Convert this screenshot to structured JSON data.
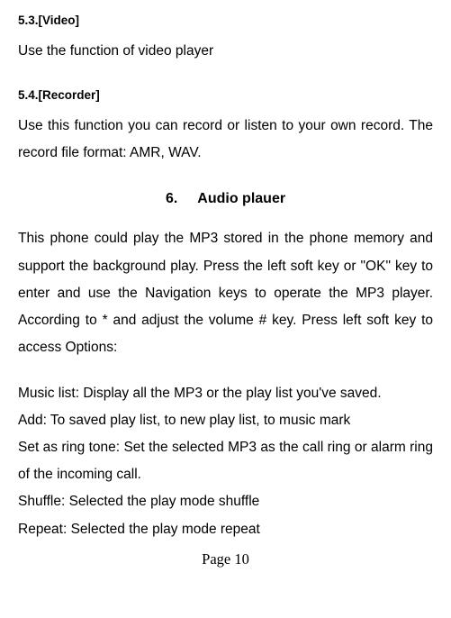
{
  "sections": {
    "video": {
      "heading": "5.3.[Video]",
      "body": "Use the function of video player"
    },
    "recorder": {
      "heading": "5.4.[Recorder]",
      "body": "Use this function you can record or listen to your own record. The record file format: AMR, WAV."
    }
  },
  "chapter": {
    "number": "6.",
    "title": "Audio plauer",
    "intro": "This phone could play the MP3 stored in the phone memory and support the background play. Press the left soft key or \"OK\" key to enter and use the Navigation keys to operate the MP3 player. According to * and adjust the volume # key. Press left soft key to access Options:",
    "items": {
      "music_list": "Music list: Display all the MP3 or the play list you've saved.",
      "add": "Add: To saved play list, to new play list, to music mark",
      "set_ring": "Set as ring tone: Set the selected MP3 as the call ring or alarm ring of the incoming call.",
      "shuffle": "Shuffle: Selected the play mode shuffle",
      "repeat": "Repeat: Selected the play mode repeat"
    }
  },
  "footer": {
    "page": "Page 10"
  }
}
